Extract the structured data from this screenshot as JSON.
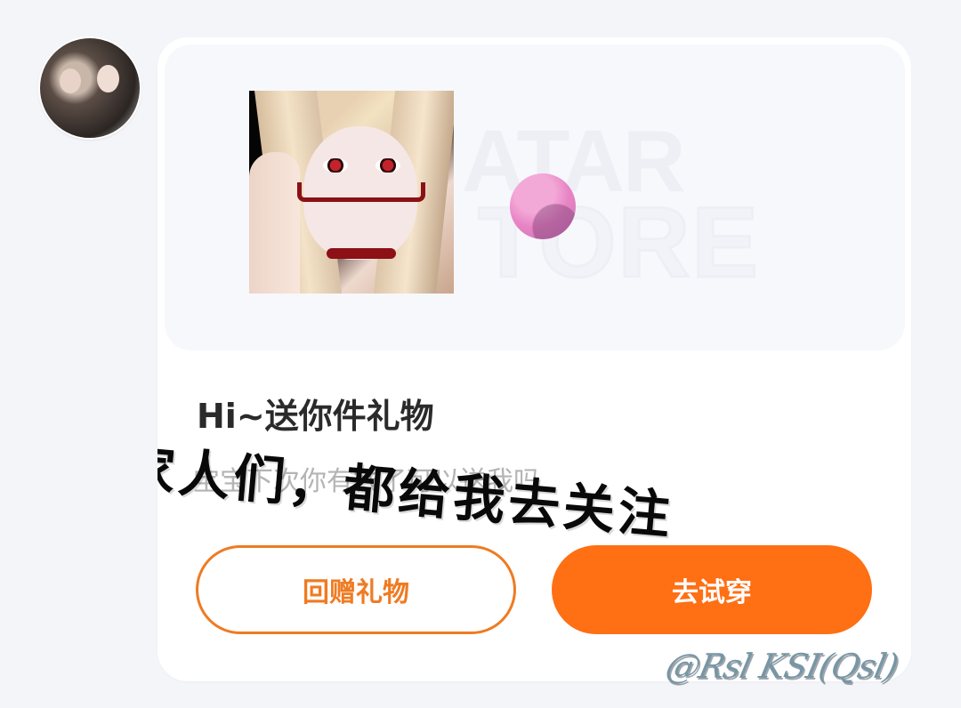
{
  "gift_card": {
    "title": "Hi~送你件礼物",
    "subtitle": "宝宝下次你有钱了可以送我吗",
    "watermark": {
      "line1": "ATAR",
      "line2": "TORE"
    },
    "buttons": {
      "return_gift": "回赠礼物",
      "try_on": "去试穿"
    }
  },
  "overlay": {
    "caption": "家人们，都给我去关注",
    "signature": "@Rsl KSI(Qsl)"
  },
  "colors": {
    "page_background": "#f4f5f9",
    "card_background": "#ffffff",
    "accent_orange": "#ff6f14",
    "outline_orange": "#ef7b22",
    "pink_item": "#e884c4"
  },
  "icons": {
    "avatar": "user-avatar-photo",
    "gift_preview": "gift-item-photo",
    "decoration": "pink-ball-icon"
  }
}
